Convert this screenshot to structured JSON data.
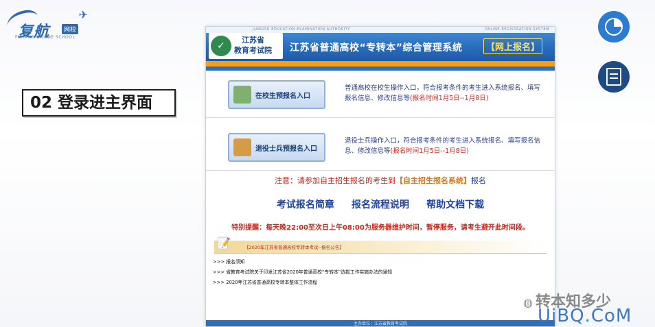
{
  "logo": {
    "brand": "复航",
    "tag": "网校",
    "subtitle": "FUHANG ONLINE SCHOOL"
  },
  "section_label": "02 登录进主界面",
  "page": {
    "header_small_left": "JIANGSU EDUCATION EXAMINATION AUTHORITY",
    "header_small_right": "ONLINE REGISTRATION SYSTEM",
    "org_name_line1": "江苏省",
    "org_name_line2": "教育考试院",
    "title": "江苏省普通高校“专转本”综合管理系统",
    "title_tag": "【网上报名】",
    "entries": [
      {
        "button": "在校生预报名入口",
        "desc": "普通高校在校生操作入口，符合报考条件的考生进入系统报名、填写报名信息、修改信息等",
        "time": "(报名时间1月5日--1月8日)"
      },
      {
        "button": "退役士兵预报名入口",
        "desc": "退役士兵操作入口，符合报考条件的考生进入系统报名、填写报名信息、修改信息等",
        "time": "(报名时间1月5日--1月8日)"
      }
    ],
    "notice_pre": "注意：请参加自主招生报名的考生到",
    "notice_sys": "【自主招生报名系统】",
    "notice_post": "报名",
    "links": [
      "考试报名简章",
      "报名流程说明",
      "帮助文档下载"
    ],
    "warning": "特别提醒：每天晚22:00至次日上午08:00为服务器维护时间，暂停服务，请考生避开此时间段。",
    "announcement_title": "【2020年江苏省普通高校专转本考试--报名公告】",
    "announcements": [
      ">>> 报名须知",
      ">>> 省教育考试院关于印发江苏省2020年普通高校“专转本”选拔工作实施办法的通知",
      ">>> 2020年江苏省普通高校专转本整体工作流程"
    ],
    "footer": "主办单位：江苏省教育考试院"
  },
  "watermark": {
    "wechat": "转本知多少",
    "site": "UiBQ.CoM"
  },
  "colors": {
    "banner_blue": "#2a6fc0",
    "accent_orange": "#f0a020",
    "link_blue": "#1d44a0",
    "warning_red": "#d0241b"
  }
}
